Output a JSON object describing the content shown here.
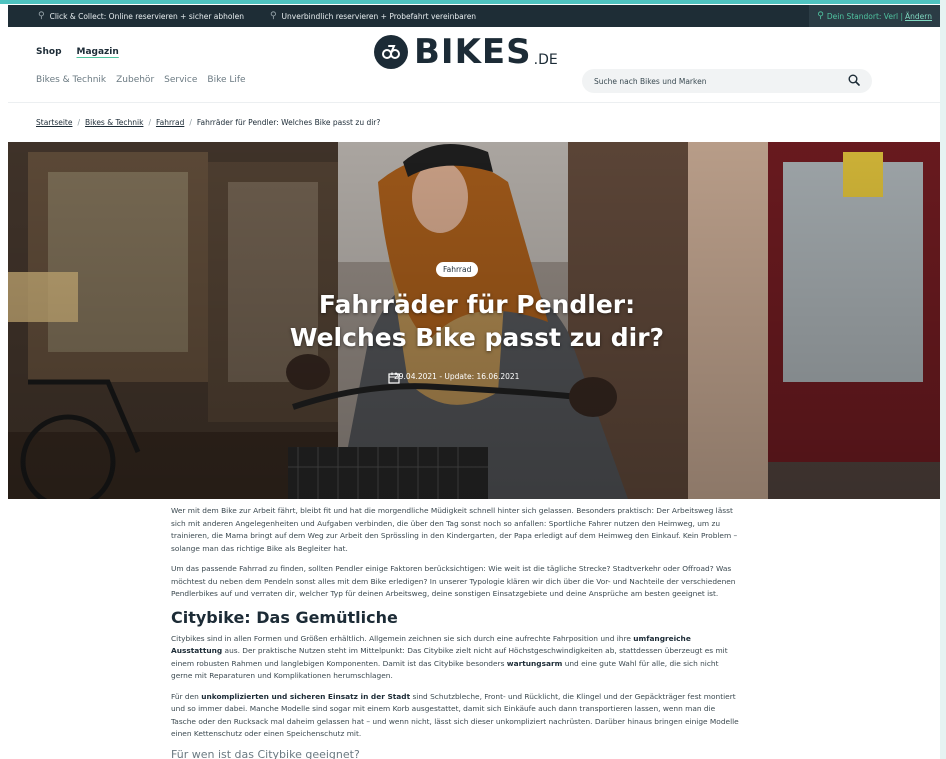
{
  "topbar": {
    "click_collect": "Click & Collect: Online reservieren + sicher abholen",
    "test_ride": "Unverbindlich reservieren + Probefahrt vereinbaren",
    "location": "Dein Standort: Verl |",
    "location_change": "Ändern"
  },
  "header": {
    "tabs": [
      "Shop",
      "Magazin"
    ],
    "nav": [
      "Bikes & Technik",
      "Zubehör",
      "Service",
      "Bike Life"
    ],
    "logo_word": "BIKES",
    "logo_tld": ".DE",
    "search_placeholder": "Suche nach Bikes und Marken"
  },
  "breadcrumb": {
    "items": [
      "Startseite",
      "Bikes & Technik",
      "Fahrrad"
    ],
    "current": "Fahrräder für Pendler: Welches Bike passt zu dir?"
  },
  "hero": {
    "category": "Fahrrad",
    "title_line1": "Fahrräder für Pendler:",
    "title_line2": "Welches Bike passt zu dir?",
    "date": "29.04.2021 - Update: 16.06.2021"
  },
  "article": {
    "p1": "Wer mit dem Bike zur Arbeit fährt, bleibt fit und hat die morgendliche Müdigkeit schnell hinter sich gelassen. Besonders praktisch: Der Arbeitsweg lässt sich mit anderen Angelegenheiten und Aufgaben verbinden, die über den Tag sonst noch so anfallen: Sportliche Fahrer nutzen den Heimweg, um zu trainieren, die Mama bringt auf dem Weg zur Arbeit den Sprössling in den Kindergarten, der Papa erledigt auf dem Heimweg den Einkauf. Kein Problem – solange man das richtige Bike als Begleiter hat.",
    "p2": "Um das passende Fahrrad zu finden, sollten Pendler einige Faktoren berücksichtigen: Wie weit ist die tägliche Strecke? Stadtverkehr oder Offroad? Was möchtest du neben dem Pendeln sonst alles mit dem Bike erledigen? In unserer Typologie klären wir dich über die Vor- und Nachteile der verschiedenen Pendlerbikes auf und verraten dir, welcher Typ für deinen Arbeitsweg, deine sonstigen Einsatzgebiete und deine Ansprüche am besten geeignet ist.",
    "h2": "Citybike: Das Gemütliche",
    "p3a": "Citybikes sind in allen Formen und Größen erhältlich. Allgemein zeichnen sie sich durch eine aufrechte Fahrposition und ihre ",
    "p3b": "umfangreiche Ausstattung",
    "p3c": " aus. Der praktische Nutzen steht im Mittelpunkt: Das Citybike zielt nicht auf Höchstgeschwindigkeiten ab, stattdessen überzeugt es mit einem robusten Rahmen und langlebigen Komponenten. Damit ist das Citybike besonders ",
    "p3d": "wartungsarm",
    "p3e": " und eine gute Wahl für alle, die sich nicht gerne mit Reparaturen und Komplikationen herumschlagen.",
    "p4a": "Für den ",
    "p4b": "unkomplizierten und sicheren Einsatz in der Stadt",
    "p4c": " sind Schutzbleche, Front- und Rücklicht, die Klingel und der Gepäckträger fest montiert und so immer dabei. Manche Modelle sind sogar mit einem Korb ausgestattet, damit sich Einkäufe auch dann transportieren lassen, wenn man die Tasche oder den Rucksack mal daheim gelassen hat – und wenn nicht, lässt sich dieser unkompliziert nachrüsten. Darüber hinaus bringen einige Modelle einen Kettenschutz oder einen Speichenschutz mit.",
    "h3": "Für wen ist das Citybike geeignet?"
  }
}
